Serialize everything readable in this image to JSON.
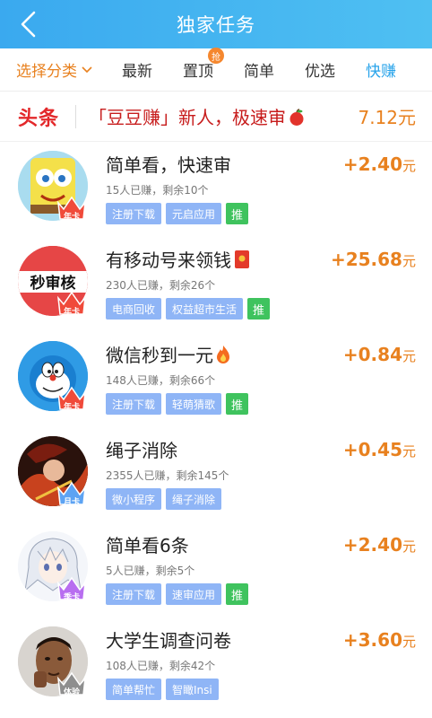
{
  "header": {
    "title": "独家任务"
  },
  "tabs": [
    {
      "label": "选择分类"
    },
    {
      "label": "最新"
    },
    {
      "label": "置顶",
      "badge": "抢"
    },
    {
      "label": "简单"
    },
    {
      "label": "优选"
    },
    {
      "label": "快赚"
    }
  ],
  "active_tab": "快赚",
  "headline": {
    "logo": "头条",
    "text": "「豆豆赚」新人，极速审",
    "reward": "7.12元"
  },
  "unit": "元",
  "tasks": [
    {
      "title": "简单看，快速审",
      "stats": "15人已赚，剩余10个",
      "tags": [
        "注册下载",
        "元启应用"
      ],
      "recommend": "推",
      "reward": "+2.40",
      "membership": "年卡"
    },
    {
      "title": "有移动号来领钱",
      "stats": "230人已赚，剩余26个",
      "tags": [
        "电商回收",
        "权益超市生活"
      ],
      "recommend": "推",
      "reward": "+25.68",
      "membership": "年卡",
      "avatar_text": "秒审核"
    },
    {
      "title": "微信秒到一元",
      "stats": "148人已赚，剩余66个",
      "tags": [
        "注册下载",
        "轻萌猜歌"
      ],
      "recommend": "推",
      "reward": "+0.84",
      "membership": "年卡"
    },
    {
      "title": "绳子消除",
      "stats": "2355人已赚，剩余145个",
      "tags": [
        "微小程序",
        "绳子消除"
      ],
      "recommend": "",
      "reward": "+0.45",
      "membership": "月卡"
    },
    {
      "title": "简单看6条",
      "stats": "5人已赚，剩余5个",
      "tags": [
        "注册下载",
        "速审应用"
      ],
      "recommend": "推",
      "reward": "+2.40",
      "membership": "季卡"
    },
    {
      "title": "大学生调查问卷",
      "stats": "108人已赚，剩余42个",
      "tags": [
        "简单帮忙",
        "智瞰Insi"
      ],
      "recommend": "",
      "reward": "+3.60",
      "membership": "体验"
    }
  ],
  "colors": {
    "header": "#3aa9ef",
    "accent_orange": "#e8811f",
    "active_blue": "#27a3ea",
    "tag_blue": "#8fb5f6",
    "tag_green": "#3fc35e",
    "headline_red": "#e3282a"
  }
}
